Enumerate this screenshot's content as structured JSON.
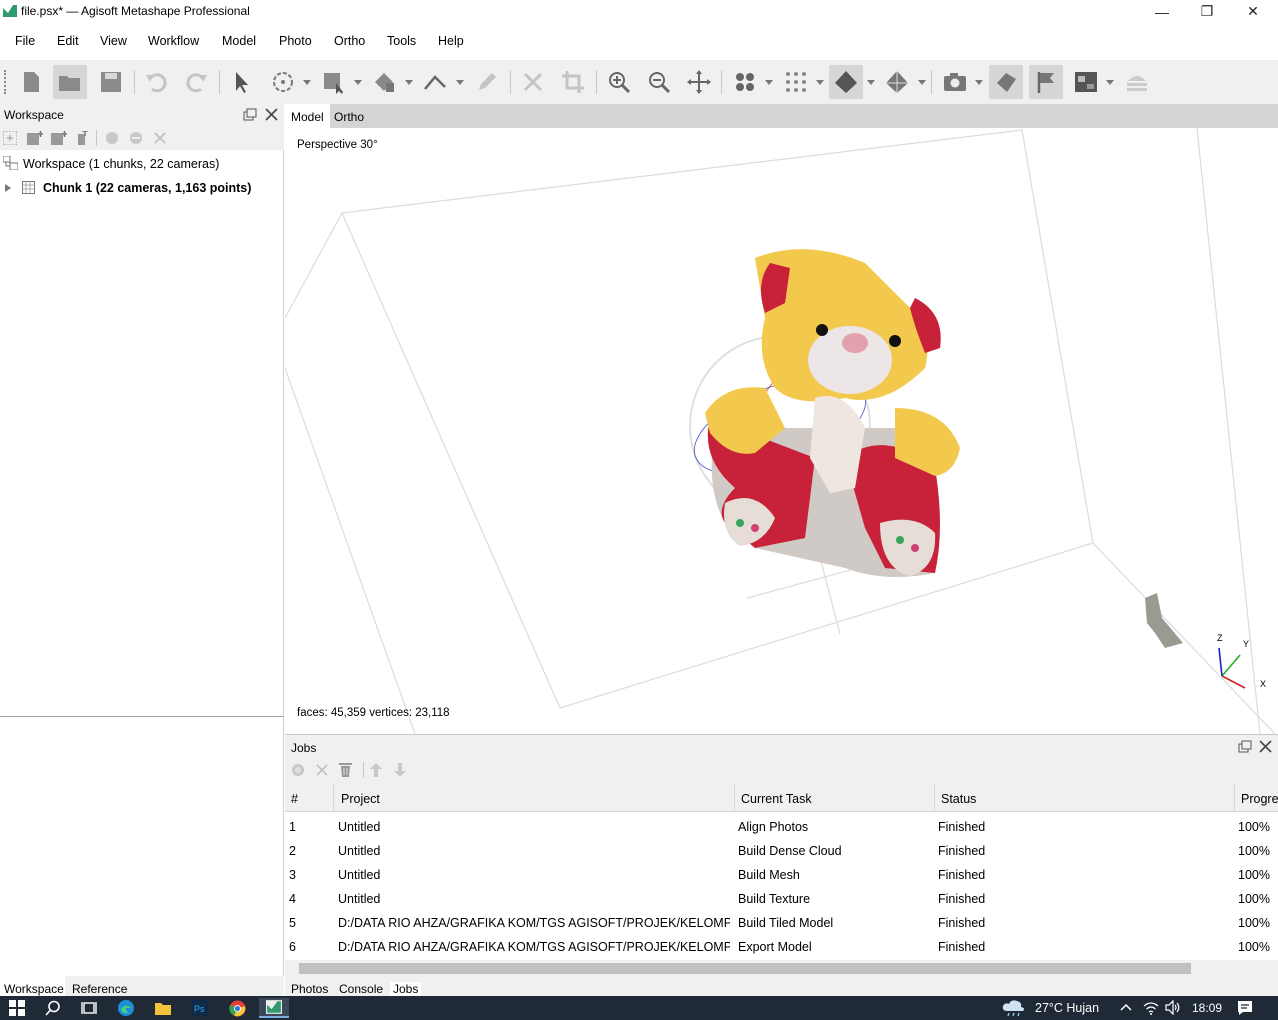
{
  "window": {
    "title": "file.psx* — Agisoft Metashape Professional",
    "minimize_glyph": "—",
    "maximize_glyph": "❐",
    "close_glyph": "✕"
  },
  "menu": {
    "items": [
      {
        "label": "File"
      },
      {
        "label": "Edit"
      },
      {
        "label": "View"
      },
      {
        "label": "Workflow"
      },
      {
        "label": "Model"
      },
      {
        "label": "Photo"
      },
      {
        "label": "Ortho"
      },
      {
        "label": "Tools"
      },
      {
        "label": "Help"
      }
    ]
  },
  "workspace": {
    "title": "Workspace",
    "root_label": "Workspace (1 chunks, 22 cameras)",
    "chunk_label": "Chunk 1 (22 cameras, 1,163 points)"
  },
  "left_tabs": {
    "workspace": "Workspace",
    "reference": "Reference"
  },
  "view": {
    "tabs": {
      "model": "Model",
      "ortho": "Ortho"
    },
    "projection_label": "Perspective 30°",
    "stats_label": "faces: 45,359 vertices: 23,118",
    "axes": {
      "x": "X",
      "y": "Y",
      "z": "Z"
    }
  },
  "jobs": {
    "title": "Jobs",
    "columns": {
      "num": "#",
      "project": "Project",
      "task": "Current Task",
      "status": "Status",
      "progress": "Progre"
    },
    "rows": [
      {
        "num": "1",
        "project": "Untitled",
        "task": "Align Photos",
        "status": "Finished",
        "progress": "100%"
      },
      {
        "num": "2",
        "project": "Untitled",
        "task": "Build Dense Cloud",
        "status": "Finished",
        "progress": "100%"
      },
      {
        "num": "3",
        "project": "Untitled",
        "task": "Build Mesh",
        "status": "Finished",
        "progress": "100%"
      },
      {
        "num": "4",
        "project": "Untitled",
        "task": "Build Texture",
        "status": "Finished",
        "progress": "100%"
      },
      {
        "num": "5",
        "project": "D:/DATA RIO AHZA/GRAFIKA KOM/TGS AGISOFT/PROJEK/KELOMPOK/fil...",
        "task": "Build Tiled Model",
        "status": "Finished",
        "progress": "100%"
      },
      {
        "num": "6",
        "project": "D:/DATA RIO AHZA/GRAFIKA KOM/TGS AGISOFT/PROJEK/KELOMPOK/fil...",
        "task": "Export Model",
        "status": "Finished",
        "progress": "100%"
      }
    ]
  },
  "bottom_tabs": {
    "photos": "Photos",
    "console": "Console",
    "jobs": "Jobs"
  },
  "taskbar": {
    "weather": "27°C  Hujan",
    "time": "18:09"
  },
  "colors": {
    "accent": "#2a7ab0",
    "taskbar": "#1f2a36",
    "teddy_yellow": "#f2c94c",
    "teddy_red": "#c8213a"
  }
}
